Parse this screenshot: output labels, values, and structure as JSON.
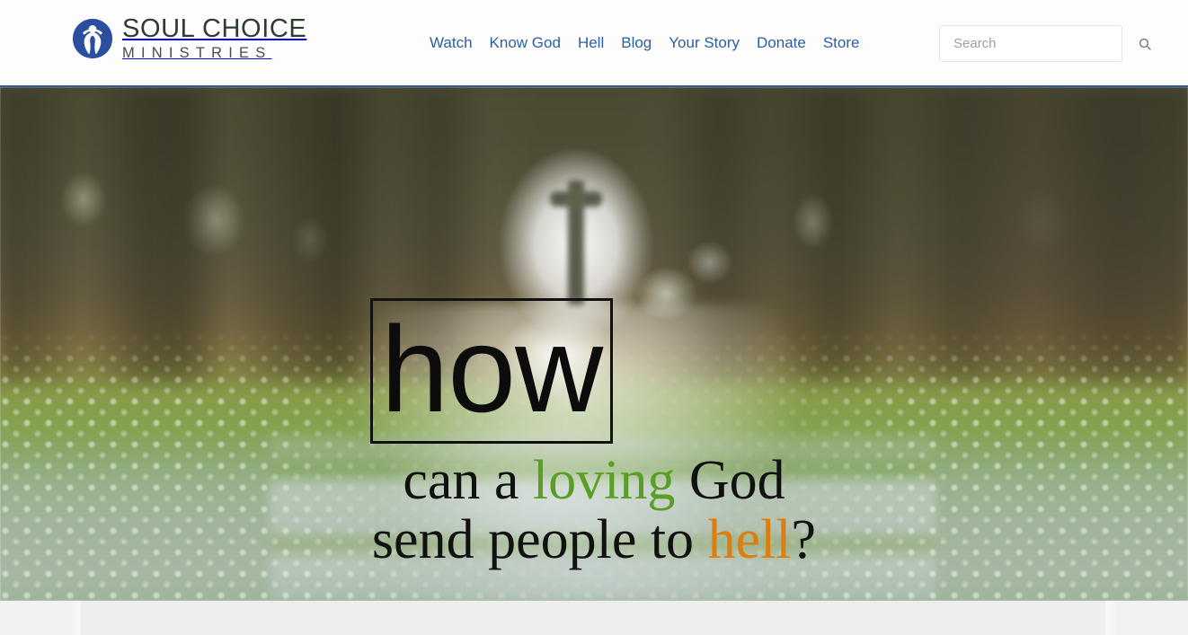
{
  "header": {
    "brand": {
      "logo_icon": "soul-choice-figure-in-circle-icon",
      "line1": "SOUL CHOICE",
      "line2": "MINISTRIES",
      "logo_color": "#2b4f9e",
      "wordmark_color": "#2e3b2e"
    },
    "nav": {
      "items": [
        {
          "label": "Watch"
        },
        {
          "label": "Know God"
        },
        {
          "label": "Hell"
        },
        {
          "label": "Blog"
        },
        {
          "label": "Your Story"
        },
        {
          "label": "Donate"
        },
        {
          "label": "Store"
        }
      ],
      "link_color": "#2b5fa0"
    },
    "search": {
      "value": "",
      "placeholder": "Search",
      "button_icon": "search-icon"
    },
    "accent_border_color": "#2b5fa0"
  },
  "hero": {
    "image_description": "blurred photograph of a stone cross at the end of a cobblestone path through dark woods with bright light behind",
    "headline": {
      "boxed_word": "how",
      "line1_part1": "can a ",
      "line1_highlight": "loving",
      "line1_part2": " God",
      "line2_part1": "send people to ",
      "line2_highlight": "hell",
      "line2_part2": "?"
    },
    "colors": {
      "boxed_word_color": "#0c0c0c",
      "box_border_color": "#111111",
      "headline_color": "#111111",
      "loving_color": "#5a9e26",
      "hell_color": "#dd7d0e"
    }
  },
  "below_fold": {
    "background_color": "#eeeeee",
    "outer_background_color": "#f2f2f2"
  }
}
